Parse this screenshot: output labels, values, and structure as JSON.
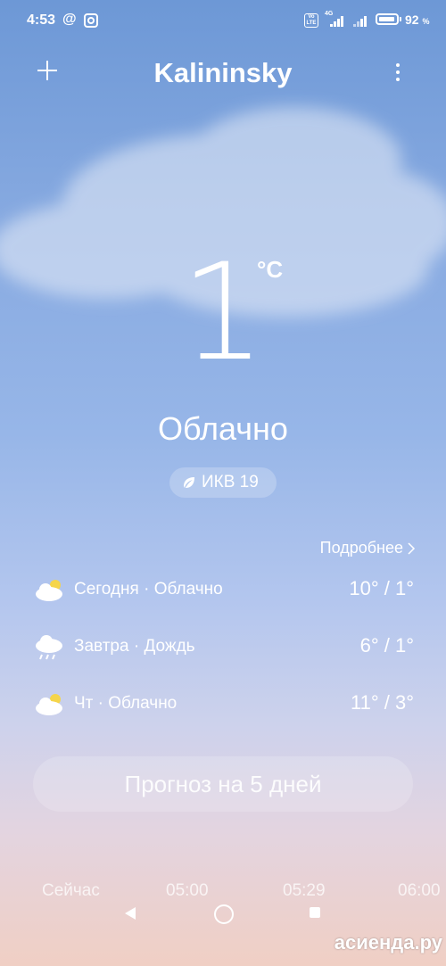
{
  "status_bar": {
    "time": "4:53",
    "at_icon": "@",
    "volte": "Vo LTE",
    "network": "4G",
    "battery_percent": "92",
    "battery_unit": "%",
    "battery_level": 0.92
  },
  "header": {
    "title": "Kalininsky",
    "add_icon": "plus-icon",
    "menu_icon": "more-vertical-icon"
  },
  "current": {
    "temperature": "1",
    "unit": "°C",
    "condition": "Облачно",
    "aqi_label": "ИКВ 19",
    "aqi_icon": "leaf-icon"
  },
  "more_link": "Подробнее",
  "forecast": [
    {
      "icon": "partly-cloudy-icon",
      "label": "Сегодня · Облачно",
      "temps": "10° / 1°"
    },
    {
      "icon": "rain-icon",
      "label": "Завтра · Дождь",
      "temps": "6° / 1°"
    },
    {
      "icon": "partly-cloudy-icon",
      "label": "Чт · Облачно",
      "temps": "11° / 3°"
    }
  ],
  "forecast_button": "Прогноз на 5 дней",
  "hourly": [
    "Сейчас",
    "05:00",
    "05:29",
    "06:00"
  ],
  "watermark": "асиенда.ру"
}
